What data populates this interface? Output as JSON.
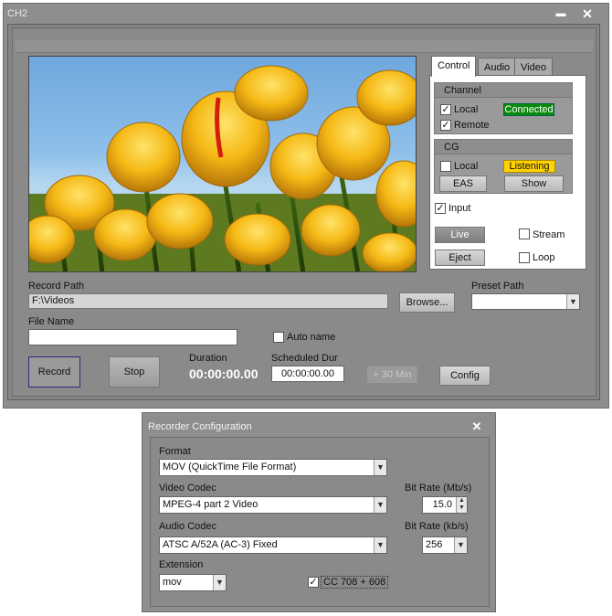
{
  "window": {
    "title": "CH2",
    "minimize": "▬",
    "close": "✕"
  },
  "tabs": [
    "Control",
    "Audio",
    "Video"
  ],
  "channel": {
    "title": "Channel",
    "local_label": "Local",
    "local_checked": "✓",
    "status": "Connected",
    "remote_label": "Remote",
    "remote_checked": "✓"
  },
  "cg": {
    "title": "CG",
    "local_label": "Local",
    "status": "Listening",
    "eas_label": "EAS",
    "show_label": "Show"
  },
  "input": {
    "label": "Input",
    "checked": "✓"
  },
  "controls": {
    "live_label": "Live",
    "stream_label": "Stream",
    "eject_label": "Eject",
    "loop_label": "Loop"
  },
  "record": {
    "path_label": "Record Path",
    "path_value": "F:\\Videos",
    "browse_label": "Browse...",
    "preset_label": "Preset Path",
    "preset_value": "",
    "file_name_label": "File Name",
    "file_name_value": "",
    "auto_name_label": "Auto name",
    "record_label": "Record",
    "stop_label": "Stop",
    "duration_label": "Duration",
    "duration_value": "00:00:00.00",
    "scheduled_label": "Scheduled Dur",
    "scheduled_value": "00:00:00.00",
    "plus30_label": "+ 30 Min",
    "config_label": "Config"
  },
  "config_dialog": {
    "title": "Recorder Configuration",
    "close": "✕",
    "format_label": "Format",
    "format_value": "MOV (QuickTime File Format)",
    "video_codec_label": "Video Codec",
    "video_codec_value": "MPEG-4 part 2 Video",
    "video_bitrate_label": "Bit Rate (Mb/s)",
    "video_bitrate_value": "15.0",
    "audio_codec_label": "Audio Codec",
    "audio_codec_value": "ATSC A/52A (AC-3) Fixed",
    "audio_bitrate_label": "Bit Rate (kb/s)",
    "audio_bitrate_value": "256",
    "extension_label": "Extension",
    "extension_value": "mov",
    "cc_label": "CC 708 + 608",
    "cc_checked": "✓"
  },
  "colors": {
    "connected": "#0a8a0a",
    "listening": "#ffd200",
    "window_bg": "#8e8e8e"
  }
}
